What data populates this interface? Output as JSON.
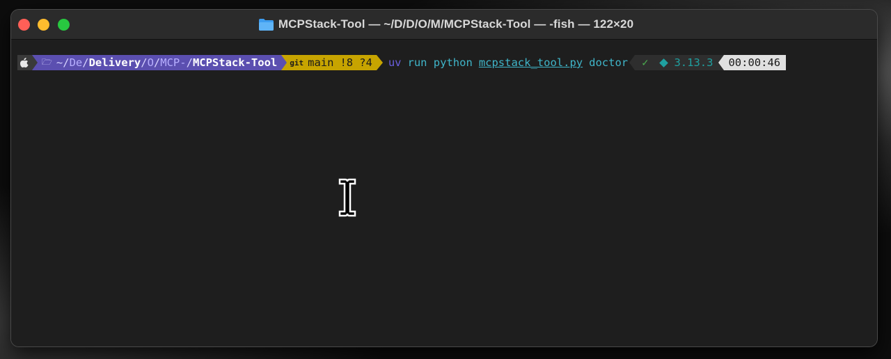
{
  "window": {
    "title": "MCPStack-Tool — ~/D/D/O/M/MCPStack-Tool — -fish — 122×20"
  },
  "prompt": {
    "apple_icon": "apple-icon",
    "folder_glyph": "🗁",
    "path_tilde": "~/",
    "path_de": "De",
    "path_sep1": "/",
    "path_delivery": "Delivery",
    "path_sep2": "/",
    "path_o": "O",
    "path_sep3": "/",
    "path_mcp": "MCP-",
    "path_sep4": "/",
    "path_last": "MCPStack-Tool",
    "git_icon": "git",
    "branch": "main",
    "modified": "!8",
    "untracked": "?4",
    "cmd_uv": "uv",
    "cmd_rest": "run python",
    "cmd_file": "mcpstack_tool.py",
    "cmd_arg": "doctor",
    "status_ok": "✓",
    "python_version": "3.13.3",
    "elapsed": "00:00:46"
  },
  "colors": {
    "path_bg": "#5b4fb0",
    "git_bg": "#c7a400",
    "command": "#3fb5c9",
    "uv": "#6b5fe0"
  }
}
